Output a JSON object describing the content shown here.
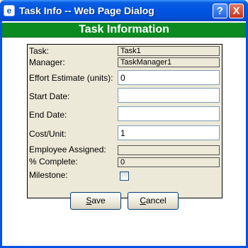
{
  "window": {
    "title": "Task Info -- Web Page Dialog",
    "help_label": "?",
    "close_label": "X"
  },
  "header": {
    "title": "Task Information"
  },
  "form": {
    "task_label": "Task:",
    "task_value": "Task1",
    "manager_label": "Manager:",
    "manager_value": "TaskManager1",
    "effort_label": "Effort Estimate (units):",
    "effort_value": "0",
    "start_label": "Start Date:",
    "start_value": "",
    "end_label": "End Date:",
    "end_value": "",
    "cost_label": "Cost/Unit:",
    "cost_value": "1",
    "employee_label": "Employee Assigned:",
    "employee_value": "",
    "complete_label": "% Complete:",
    "complete_value": "0",
    "milestone_label": "Milestone:",
    "milestone_checked": false
  },
  "buttons": {
    "save_first": "S",
    "save_rest": "ave",
    "cancel_first": "C",
    "cancel_rest": "ancel"
  }
}
